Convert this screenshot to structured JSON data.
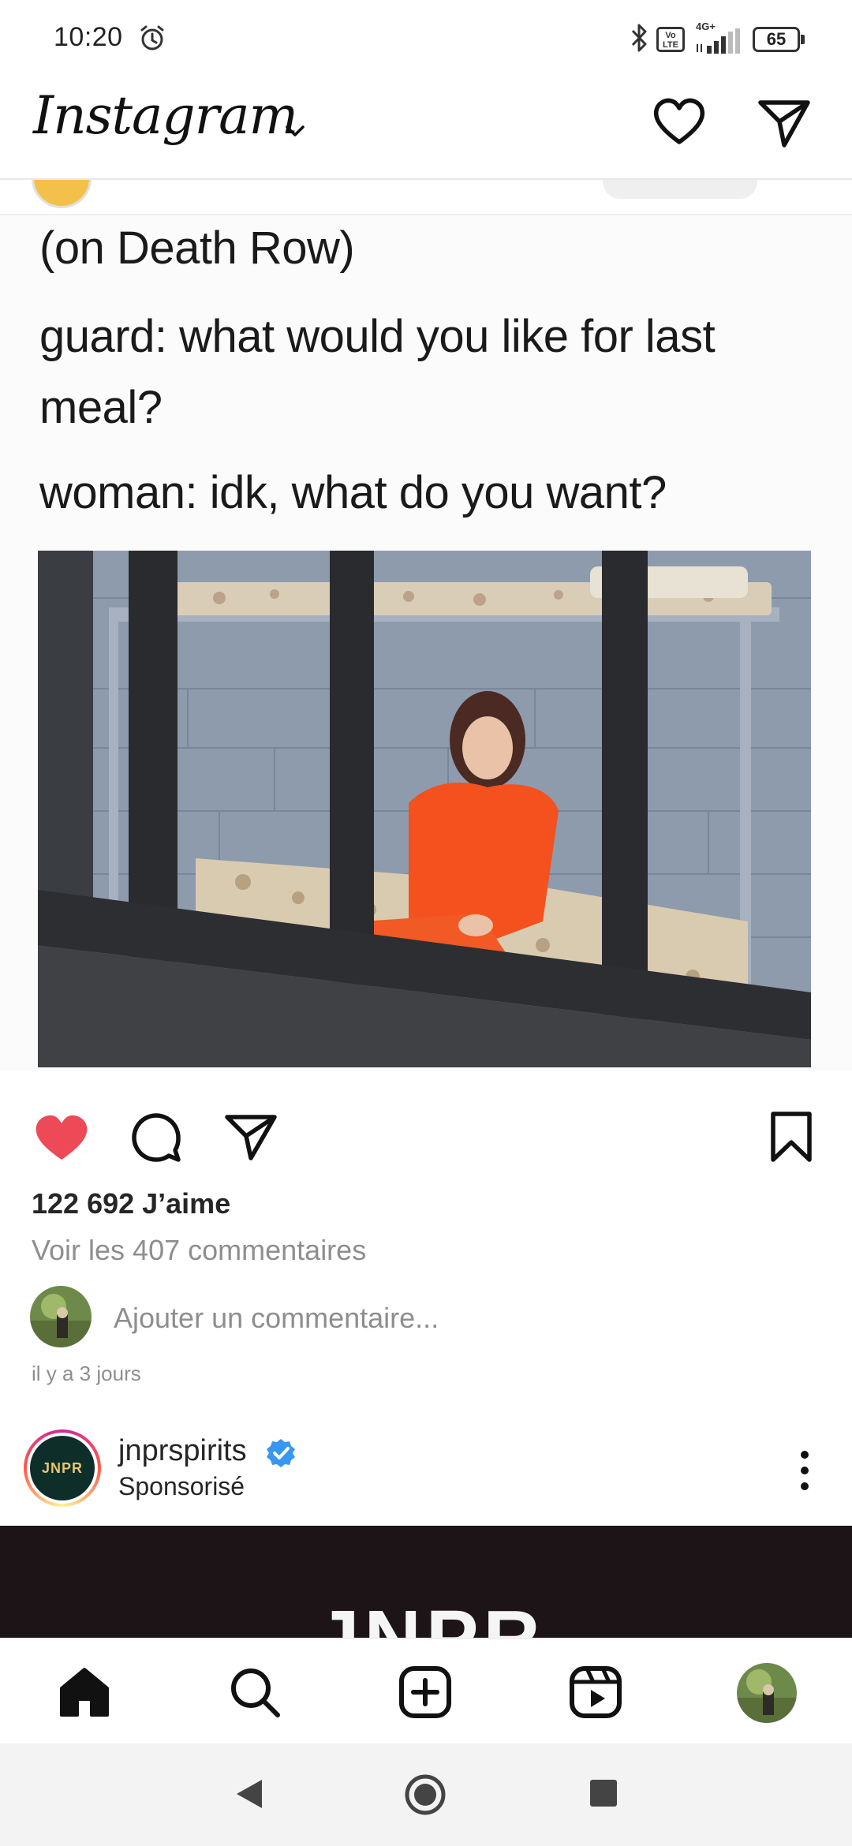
{
  "status_bar": {
    "time": "10:20",
    "network": "4G+",
    "volte": "Vo LTE",
    "battery_level": "65",
    "icons": [
      "alarm-icon",
      "bluetooth-icon",
      "volte-icon",
      "signal-icon",
      "battery-icon"
    ]
  },
  "header": {
    "app_name": "Instagram",
    "icons": [
      "chevron-down-icon",
      "heart-icon",
      "direct-message-icon"
    ]
  },
  "post": {
    "meme_lines": [
      "(on Death Row)",
      "guard: what would you like for last",
      "meal?",
      "woman: idk, what do you want?"
    ],
    "liked": true,
    "likes": "122 692 J’aime",
    "view_comments": "Voir les 407 commentaires",
    "add_comment_placeholder": "Ajouter un commentaire...",
    "timestamp": "il y a 3 jours"
  },
  "sponsored_post": {
    "username": "jnprspirits",
    "avatar_text": "JNPR",
    "label": "Sponsorisé",
    "verified": true,
    "ad_text": "JNPR"
  },
  "bottom_nav": {
    "items": [
      "home-icon",
      "search-icon",
      "create-icon",
      "reels-icon",
      "profile-avatar"
    ],
    "active": "home-icon"
  },
  "colors": {
    "like_red": "#ed4956",
    "verified_blue": "#3897f0",
    "prison_orange": "#f4511e"
  }
}
